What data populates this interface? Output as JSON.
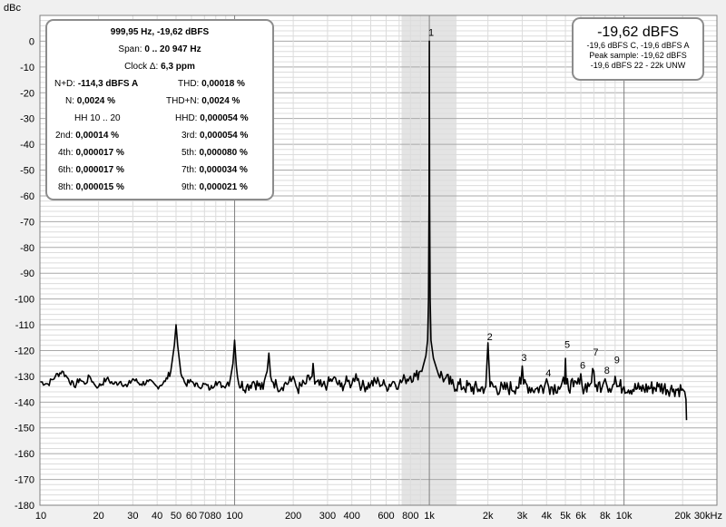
{
  "chart_data": {
    "type": "line",
    "ylabel": "dBc",
    "x_scale": "log",
    "xlim": [
      10,
      30000
    ],
    "ylim": [
      -180,
      10
    ],
    "y_ticks": [
      "0",
      "-10",
      "-20",
      "-30",
      "-40",
      "-50",
      "-60",
      "-70",
      "-80",
      "-90",
      "-100",
      "-110",
      "-120",
      "-130",
      "-140",
      "-150",
      "-160",
      "-170",
      "-180"
    ],
    "x_tick_labels": [
      {
        "v": 10,
        "t": "10"
      },
      {
        "v": 20,
        "t": "20"
      },
      {
        "v": 30,
        "t": "30"
      },
      {
        "v": 40,
        "t": "40"
      },
      {
        "v": 50,
        "t": "50"
      },
      {
        "v": 60,
        "t": "60"
      },
      {
        "v": 70,
        "t": "70"
      },
      {
        "v": 80,
        "t": "80"
      },
      {
        "v": 100,
        "t": "100"
      },
      {
        "v": 200,
        "t": "200"
      },
      {
        "v": 300,
        "t": "300"
      },
      {
        "v": 400,
        "t": "400"
      },
      {
        "v": 600,
        "t": "600"
      },
      {
        "v": 800,
        "t": "800"
      },
      {
        "v": 1000,
        "t": "1k"
      },
      {
        "v": 2000,
        "t": "2k"
      },
      {
        "v": 3000,
        "t": "3k"
      },
      {
        "v": 4000,
        "t": "4k"
      },
      {
        "v": 5000,
        "t": "5k"
      },
      {
        "v": 6000,
        "t": "6k"
      },
      {
        "v": 8000,
        "t": "8k"
      },
      {
        "v": 10000,
        "t": "10k"
      },
      {
        "v": 20000,
        "t": "20k"
      },
      {
        "v": 30000,
        "t": "30kHz"
      }
    ],
    "grid": true,
    "highlight_band": [
      720,
      1380
    ],
    "series": [
      {
        "points": [
          [
            10,
            -132
          ],
          [
            11,
            -133
          ],
          [
            12,
            -130
          ],
          [
            13,
            -128
          ],
          [
            14,
            -131
          ],
          [
            15,
            -134
          ],
          [
            16,
            -131
          ],
          [
            17,
            -133
          ],
          [
            18,
            -130
          ],
          [
            19,
            -133
          ],
          [
            20,
            -134
          ],
          [
            22,
            -131
          ],
          [
            24,
            -133
          ],
          [
            26,
            -132
          ],
          [
            28,
            -134
          ],
          [
            30,
            -131
          ],
          [
            33,
            -133
          ],
          [
            36,
            -132
          ],
          [
            40,
            -134
          ],
          [
            44,
            -132
          ],
          [
            47,
            -128
          ],
          [
            49,
            -118
          ],
          [
            50,
            -110
          ],
          [
            51,
            -118
          ],
          [
            53,
            -129
          ],
          [
            56,
            -133
          ],
          [
            60,
            -132
          ],
          [
            65,
            -134
          ],
          [
            70,
            -133
          ],
          [
            75,
            -135
          ],
          [
            80,
            -132
          ],
          [
            88,
            -134
          ],
          [
            95,
            -131
          ],
          [
            98,
            -125
          ],
          [
            100,
            -116
          ],
          [
            102,
            -126
          ],
          [
            105,
            -133
          ],
          [
            115,
            -134
          ],
          [
            125,
            -132
          ],
          [
            140,
            -135
          ],
          [
            147,
            -128
          ],
          [
            150,
            -121
          ],
          [
            153,
            -130
          ],
          [
            165,
            -134
          ],
          [
            180,
            -133
          ],
          [
            195,
            -132
          ],
          [
            200,
            -130
          ],
          [
            210,
            -135
          ],
          [
            230,
            -133
          ],
          [
            250,
            -130
          ],
          [
            253,
            -125
          ],
          [
            258,
            -133
          ],
          [
            280,
            -134
          ],
          [
            300,
            -133
          ],
          [
            320,
            -131
          ],
          [
            350,
            -134
          ],
          [
            380,
            -132
          ],
          [
            400,
            -133
          ],
          [
            420,
            -129
          ],
          [
            450,
            -134
          ],
          [
            500,
            -133
          ],
          [
            550,
            -132
          ],
          [
            600,
            -134
          ],
          [
            650,
            -132
          ],
          [
            700,
            -133
          ],
          [
            750,
            -131
          ],
          [
            800,
            -130
          ],
          [
            850,
            -130
          ],
          [
            900,
            -128
          ],
          [
            930,
            -126
          ],
          [
            960,
            -122
          ],
          [
            980,
            -116
          ],
          [
            990,
            -100
          ],
          [
            997,
            -60
          ],
          [
            1000,
            0
          ],
          [
            1003,
            -60
          ],
          [
            1010,
            -100
          ],
          [
            1020,
            -116
          ],
          [
            1050,
            -123
          ],
          [
            1100,
            -128
          ],
          [
            1200,
            -131
          ],
          [
            1300,
            -133
          ],
          [
            1500,
            -134
          ],
          [
            1800,
            -135
          ],
          [
            1950,
            -134
          ],
          [
            2000,
            -117
          ],
          [
            2050,
            -134
          ],
          [
            2400,
            -135
          ],
          [
            2800,
            -134
          ],
          [
            2950,
            -133
          ],
          [
            3000,
            -126
          ],
          [
            3050,
            -133
          ],
          [
            3500,
            -135
          ],
          [
            3900,
            -134
          ],
          [
            4000,
            -131
          ],
          [
            4100,
            -134
          ],
          [
            4600,
            -134
          ],
          [
            4950,
            -133
          ],
          [
            5000,
            -123
          ],
          [
            5050,
            -133
          ],
          [
            5500,
            -134
          ],
          [
            5900,
            -133
          ],
          [
            6000,
            -129
          ],
          [
            6100,
            -134
          ],
          [
            6700,
            -133
          ],
          [
            7000,
            -128
          ],
          [
            7100,
            -134
          ],
          [
            7800,
            -133
          ],
          [
            8000,
            -131
          ],
          [
            8200,
            -134
          ],
          [
            8900,
            -133
          ],
          [
            9000,
            -130
          ],
          [
            9200,
            -134
          ],
          [
            10000,
            -134
          ],
          [
            12000,
            -135
          ],
          [
            15000,
            -134
          ],
          [
            18000,
            -135
          ],
          [
            20000,
            -135
          ],
          [
            20500,
            -136
          ],
          [
            20800,
            -139
          ],
          [
            20947,
            -147
          ]
        ]
      }
    ],
    "markers": [
      {
        "label": "1",
        "x": 1000,
        "y": 2
      },
      {
        "label": "2",
        "x": 2000,
        "y": -116
      },
      {
        "label": "3",
        "x": 3000,
        "y": -124
      },
      {
        "label": "4",
        "x": 4000,
        "y": -130
      },
      {
        "label": "5",
        "x": 5000,
        "y": -119
      },
      {
        "label": "6",
        "x": 6000,
        "y": -127
      },
      {
        "label": "7",
        "x": 7000,
        "y": -122
      },
      {
        "label": "8",
        "x": 8000,
        "y": -129
      },
      {
        "label": "9",
        "x": 9000,
        "y": -125
      }
    ]
  },
  "info": {
    "freq_level": "999,95 Hz, -19,62 dBFS",
    "span_label": "Span: ",
    "span_value": "0 .. 20 947 Hz",
    "clock_label": "Clock Δ: ",
    "clock_value": "6,3 ppm",
    "nd_label": "N+D:",
    "nd_value": "-114,3 dBFS A",
    "thd_label": "THD:",
    "thd_value": "0,00018 %",
    "n_label": "N:",
    "n_value": "0,0024 %",
    "thdn_label": "THD+N:",
    "thdn_value": "0,0024 %",
    "hh_label": "HH 10 .. 20",
    "hhd_label": "HHD:",
    "hhd_value": "0,000054 %",
    "h2_label": "2nd:",
    "h2_value": "0,00014 %",
    "h3_label": "3rd:",
    "h3_value": "0,000054 %",
    "h4_label": "4th:",
    "h4_value": "0,000017 %",
    "h5_label": "5th:",
    "h5_value": "0,000080 %",
    "h6_label": "6th:",
    "h6_value": "0,000017 %",
    "h7_label": "7th:",
    "h7_value": "0,000034 %",
    "h8_label": "8th:",
    "h8_value": "0,000015 %",
    "h9_label": "9th:",
    "h9_value": "0,000021 %"
  },
  "level": {
    "main": "-19,62 dBFS",
    "line1": "-19,6 dBFS C, -19,6 dBFS A",
    "line2": "Peak sample: -19,62 dBFS",
    "line3": "-19,6 dBFS 22 - 22k UNW"
  },
  "colors": {
    "plot_bg": "#ffffff",
    "grid_minor": "#dcdcdc",
    "grid_major": "#a8a8a8",
    "band": "#e4e4e4",
    "trace": "#000000",
    "box_border": "#8c8c8c"
  }
}
